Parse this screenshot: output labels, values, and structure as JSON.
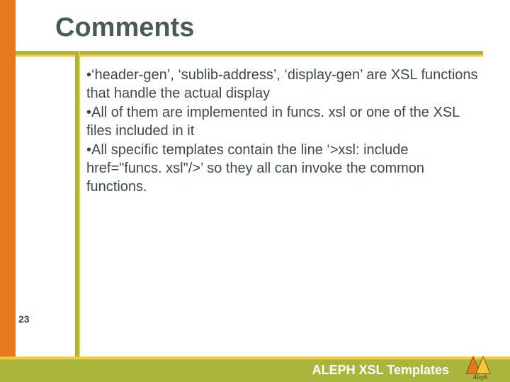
{
  "title": "Comments",
  "bullets": [
    "‘header-gen’, ‘sublib-address’, ‘display-gen’ are XSL functions that handle the actual display",
    "All of them are implemented in funcs. xsl or one of the XSL files included in it",
    "All specific templates contain the line ‘>xsl: include href=\"funcs. xsl\"/>’ so they all can invoke the common functions."
  ],
  "slide_number": "23",
  "footer": "ALEPH XSL Templates",
  "logo_name": "Aleph",
  "colors": {
    "orange": "#e77a1e",
    "green": "#a9b63b",
    "yellow": "#f4c93d",
    "text": "#3e4a4a",
    "title": "#4a5a5a"
  }
}
